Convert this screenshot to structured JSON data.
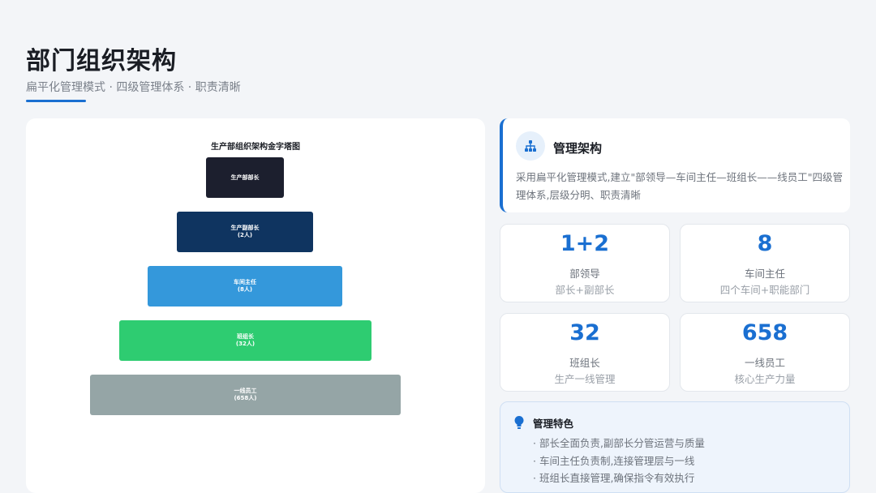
{
  "header": {
    "title": "部门组织架构",
    "subtitle": "扁平化管理模式 · 四级管理体系 · 职责清晰"
  },
  "pyramid": {
    "title": "生产部组织架构金字塔图",
    "levels": [
      {
        "name": "生产部部长",
        "count": "",
        "color": "#1c1f2e"
      },
      {
        "name": "生产副部长",
        "count": "(2人)",
        "color": "#0f3460"
      },
      {
        "name": "车间主任",
        "count": "(8人)",
        "color": "#3498db"
      },
      {
        "name": "班组长",
        "count": "(32人)",
        "color": "#2ecc71"
      },
      {
        "name": "一线员工",
        "count": "(658人)",
        "color": "#95a5a6"
      }
    ]
  },
  "management": {
    "icon": "org-chart-icon",
    "title": "管理架构",
    "description": "采用扁平化管理模式,建立\"部领导—车间主任—班组长——线员工\"四级管理体系,层级分明、职责清晰"
  },
  "stats": [
    {
      "value": "1+2",
      "label": "部领导",
      "sub": "部长+副部长"
    },
    {
      "value": "8",
      "label": "车间主任",
      "sub": "四个车间+职能部门"
    },
    {
      "value": "32",
      "label": "班组长",
      "sub": "生产一线管理"
    },
    {
      "value": "658",
      "label": "一线员工",
      "sub": "核心生产力量"
    }
  ],
  "features": {
    "icon": "lightbulb-icon",
    "title": "管理特色",
    "items": [
      "部长全面负责,副部长分管运营与质量",
      "车间主任负责制,连接管理层与一线",
      "班组长直接管理,确保指令有效执行"
    ]
  },
  "colors": {
    "accent": "#1a6fd1",
    "background": "#f3f5f8"
  }
}
